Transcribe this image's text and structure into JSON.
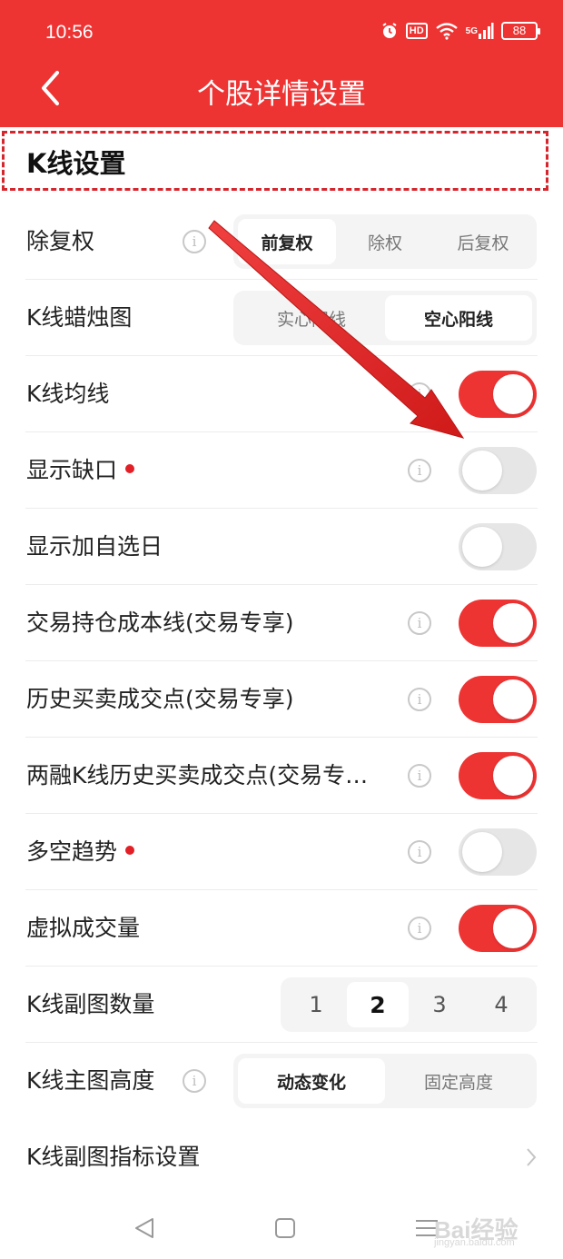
{
  "status_bar": {
    "time": "10:56",
    "hd_label": "HD",
    "signal_label": "5G",
    "battery": "88",
    "icons": [
      "alarm-icon",
      "hd-icon",
      "wifi-icon",
      "signal-5g-icon",
      "battery-icon"
    ]
  },
  "header": {
    "title": "个股详情设置",
    "back_icon": "chevron-left-icon",
    "background": "#ee3333"
  },
  "section": {
    "title": "K线设置"
  },
  "rows": [
    {
      "label": "除复权",
      "control": "segmented",
      "info": true,
      "options": [
        "前复权",
        "除权",
        "后复权"
      ],
      "selected": 0
    },
    {
      "label": "K线蜡烛图",
      "control": "segmented",
      "info": false,
      "options": [
        "实心阳线",
        "空心阳线"
      ],
      "selected": 1
    },
    {
      "label": "K线均线",
      "control": "toggle",
      "info": true,
      "on": true
    },
    {
      "label": "显示缺口",
      "control": "toggle",
      "info": true,
      "on": false,
      "new_dot": true
    },
    {
      "label": "显示加自选日",
      "control": "toggle",
      "info": false,
      "on": false
    },
    {
      "label": "交易持仓成本线(交易专享)",
      "control": "toggle",
      "info": true,
      "on": true
    },
    {
      "label": "历史买卖成交点(交易专享)",
      "control": "toggle",
      "info": true,
      "on": true
    },
    {
      "label": "两融K线历史买卖成交点(交易专…",
      "control": "toggle",
      "info": true,
      "on": true
    },
    {
      "label": "多空趋势",
      "control": "toggle",
      "info": true,
      "on": false,
      "new_dot": true
    },
    {
      "label": "虚拟成交量",
      "control": "toggle",
      "info": true,
      "on": true
    },
    {
      "label": "K线副图数量",
      "control": "segmented",
      "info": false,
      "options": [
        "1",
        "2",
        "3",
        "4"
      ],
      "selected": 1
    },
    {
      "label": "K线主图高度",
      "control": "segmented",
      "info": true,
      "options": [
        "动态变化",
        "固定高度"
      ],
      "selected": 0
    },
    {
      "label": "K线副图指标设置",
      "control": "link",
      "info": false
    }
  ],
  "info_glyph": "i",
  "nav_bar": {
    "icons": [
      "back-triangle-icon",
      "home-square-icon",
      "menu-lines-icon"
    ]
  },
  "watermark": {
    "text": "Bai经验",
    "sub": "jingyan.baidu.com"
  },
  "colors": {
    "accent": "#ee3333",
    "toggle_off": "#e6e6e6",
    "annotation": "#e21f26"
  }
}
